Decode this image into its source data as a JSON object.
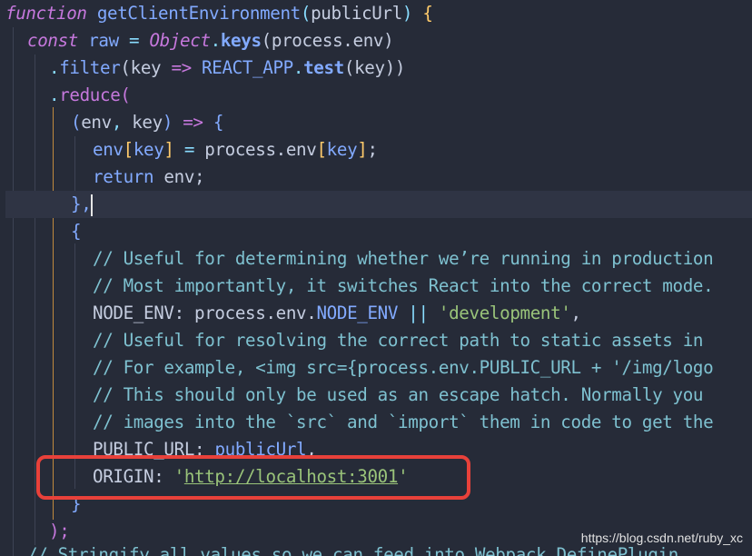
{
  "code": {
    "l1": {
      "kw": "function",
      "name": "getClientEnvironment",
      "open": "(",
      "param": "publicUrl",
      "close": ")",
      "brace": "{"
    },
    "l2": {
      "kw": "const",
      "var": "raw",
      "eq": "=",
      "obj": "Object",
      "dot": ".",
      "method": "keys",
      "open": "(",
      "arg": "process.env",
      "close": ")"
    },
    "l3": {
      "dot": ".",
      "method": "filter",
      "open": "(",
      "param": "key",
      "arrow": "=>",
      "re": "REACT_APP",
      "dot2": ".",
      "test": "test",
      "open2": "(",
      "arg": "key",
      "close": "))"
    },
    "l4": {
      "dot": ".",
      "method": "reduce",
      "open": "("
    },
    "l5": {
      "open": "(",
      "a": "env",
      "comma": ", ",
      "b": "key",
      "close": ")",
      "arrow": "=>",
      "brace": "{"
    },
    "l6": {
      "obj": "env",
      "lb": "[",
      "key": "key",
      "rb": "]",
      "eq": "=",
      "src": "process.env",
      "lb2": "[",
      "key2": "key",
      "rb2": "]",
      "semi": ";"
    },
    "l7": {
      "kw": "return",
      "val": "env",
      "semi": ";"
    },
    "l8": {
      "text": "},"
    },
    "l9": {
      "text": "{"
    },
    "l10": {
      "text": "// Useful for determining whether we’re running in production"
    },
    "l11": {
      "text": "// Most importantly, it switches React into the correct mode."
    },
    "l12": {
      "key": "NODE_ENV",
      "colon": ":",
      "src": "process.env.",
      "prop": "NODE_ENV",
      "or": "||",
      "str": "'development'",
      "comma": ","
    },
    "l13": {
      "text": "// Useful for resolving the correct path to static assets in"
    },
    "l14": {
      "text": "// For example, <img src={process.env.PUBLIC_URL + '/img/logo"
    },
    "l15": {
      "text": "// This should only be used as an escape hatch. Normally you"
    },
    "l16": {
      "text": "// images into the `src` and `import` them in code to get the"
    },
    "l17": {
      "key": "PUBLIC_URL",
      "colon": ":",
      "val": "publicUrl",
      "comma": ","
    },
    "l18": {
      "key": "ORIGIN",
      "colon": ":",
      "q1": "'",
      "url": "http://localhost:3001",
      "q2": "'"
    },
    "l19": {
      "text": "}"
    },
    "l20": {
      "text": ");"
    },
    "l21": {
      "text": "// Stringify all values so we can feed into Webpack DefinePlugin"
    }
  },
  "watermark": "https://blog.csdn.net/ruby_xc",
  "colors": {
    "background": "#262b38",
    "keyword": "#c678dd",
    "function": "#82aaff",
    "comment": "#7ec1d0",
    "string": "#9ac47a",
    "bracket": "#ffcb6b",
    "highlight_box": "#e8413a"
  }
}
